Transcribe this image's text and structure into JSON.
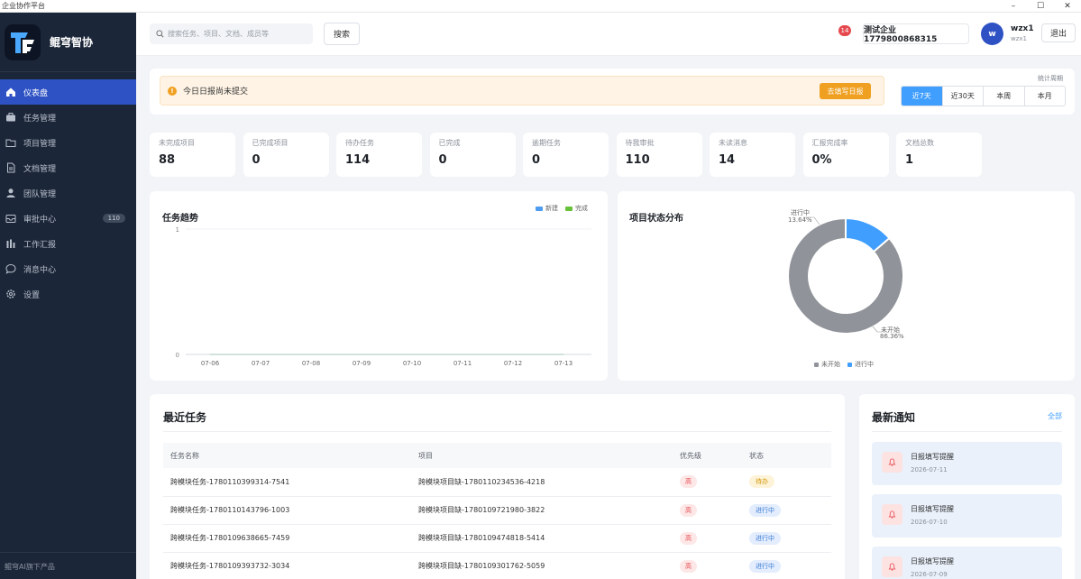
{
  "window": {
    "title": "企业协作平台",
    "controls": [
      "–",
      "☐",
      "✕"
    ]
  },
  "brand": {
    "logo_text": "TF",
    "name": "鲲穹智协"
  },
  "sidebar": {
    "items": [
      {
        "label": "仪表盘",
        "icon": "home-icon",
        "active": true
      },
      {
        "label": "任务管理",
        "icon": "briefcase-icon"
      },
      {
        "label": "项目管理",
        "icon": "folder-icon"
      },
      {
        "label": "文档管理",
        "icon": "document-icon"
      },
      {
        "label": "团队管理",
        "icon": "user-icon"
      },
      {
        "label": "审批中心",
        "icon": "inbox-icon",
        "badge": "110"
      },
      {
        "label": "工作汇报",
        "icon": "report-icon"
      },
      {
        "label": "消息中心",
        "icon": "message-icon"
      },
      {
        "label": "设置",
        "icon": "gear-icon"
      }
    ],
    "footer": "鲲穹AI旗下产品"
  },
  "header": {
    "search_placeholder": "搜索任务、项目、文档、成员等",
    "search_button": "搜索",
    "notification_count": "14",
    "company": "测试企业1779800868315",
    "avatar_letter": "w",
    "user_name": "wzx1",
    "user_sub": "wzx1",
    "logout": "退出"
  },
  "alert": {
    "icon": "!",
    "text": "今日日报尚未提交",
    "button": "去填写日报",
    "period_label": "统计周期",
    "periods": [
      "近7天",
      "近30天",
      "本周",
      "本月"
    ],
    "active_period": "近7天"
  },
  "stats": [
    {
      "label": "未完成项目",
      "value": "88"
    },
    {
      "label": "已完成项目",
      "value": "0"
    },
    {
      "label": "待办任务",
      "value": "114"
    },
    {
      "label": "已完成",
      "value": "0"
    },
    {
      "label": "逾期任务",
      "value": "0"
    },
    {
      "label": "待我审批",
      "value": "110"
    },
    {
      "label": "未读消息",
      "value": "14"
    },
    {
      "label": "汇报完成率",
      "value": "0%"
    },
    {
      "label": "文档总数",
      "value": "1"
    }
  ],
  "chart_data": [
    {
      "type": "line",
      "title": "任务趋势",
      "x": [
        "07-06",
        "07-07",
        "07-08",
        "07-09",
        "07-10",
        "07-11",
        "07-12",
        "07-13"
      ],
      "series": [
        {
          "name": "新建",
          "values": [
            0,
            0,
            0,
            0,
            0,
            0,
            0,
            0
          ],
          "color": "#4e9cf0"
        },
        {
          "name": "完成",
          "values": [
            0,
            0,
            0,
            0,
            0,
            0,
            0,
            0
          ],
          "color": "#67c23a"
        }
      ],
      "ylim": [
        0,
        1
      ],
      "yticks": [
        "1",
        "0"
      ],
      "grid": true,
      "legend": "top-right"
    },
    {
      "type": "pie",
      "title": "项目状态分布",
      "slices": [
        {
          "name": "未开始",
          "value": 86.36,
          "label": "86.36%",
          "color": "#909399"
        },
        {
          "name": "进行中",
          "value": 13.64,
          "label": "13.64%",
          "color": "#409eff"
        }
      ],
      "legend": "bottom"
    }
  ],
  "tasks": {
    "title": "最近任务",
    "columns": [
      "任务名称",
      "项目",
      "优先级",
      "状态"
    ],
    "rows": [
      {
        "name": "跨模块任务-1780110399314-7541",
        "project": "跨模块项目缺-1780110234536-4218",
        "priority": "高",
        "status": "待办",
        "status_type": "todo"
      },
      {
        "name": "跨模块任务-1780110143796-1003",
        "project": "跨模块项目缺-1780109721980-3822",
        "priority": "高",
        "status": "进行中",
        "status_type": "doing"
      },
      {
        "name": "跨模块任务-1780109638665-7459",
        "project": "跨模块项目缺-1780109474818-5414",
        "priority": "高",
        "status": "进行中",
        "status_type": "doing"
      },
      {
        "name": "跨模块任务-1780109393732-3034",
        "project": "跨模块项目缺-1780109301762-5059",
        "priority": "高",
        "status": "进行中",
        "status_type": "doing"
      }
    ]
  },
  "notices": {
    "title": "最新通知",
    "all": "全部",
    "items": [
      {
        "name": "日报填写提醒",
        "date": "2026-07-11",
        "icon": "bell-icon"
      },
      {
        "name": "日报填写提醒",
        "date": "2026-07-10",
        "icon": "bell-icon"
      },
      {
        "name": "日报填写提醒",
        "date": "2026-07-09",
        "icon": "bell-icon"
      }
    ]
  }
}
